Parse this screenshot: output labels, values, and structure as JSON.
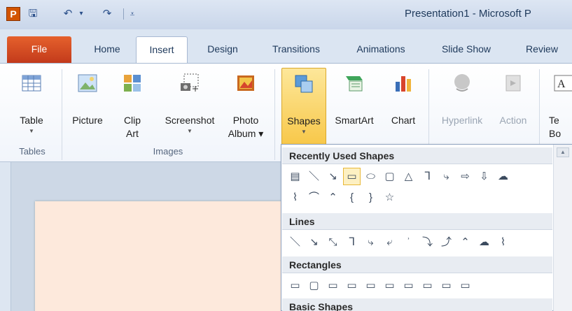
{
  "window": {
    "title": "Presentation1  -  Microsoft P",
    "app_icon": "P"
  },
  "qat": {
    "save": "🖫",
    "undo": "↶",
    "undo_more": "▾",
    "redo": "↷",
    "customize": "⩡"
  },
  "tabs": [
    {
      "label": "File"
    },
    {
      "label": "Home"
    },
    {
      "label": "Insert"
    },
    {
      "label": "Design"
    },
    {
      "label": "Transitions"
    },
    {
      "label": "Animations"
    },
    {
      "label": "Slide Show"
    },
    {
      "label": "Review"
    }
  ],
  "groups": {
    "tables": "Tables",
    "images": "Images"
  },
  "buttons": {
    "table": {
      "label": "Table"
    },
    "picture": {
      "label": "Picture"
    },
    "clip_art": {
      "label": "Clip",
      "label2": "Art"
    },
    "screenshot": {
      "label": "Screenshot"
    },
    "photo_album": {
      "label": "Photo",
      "label2": "Album ▾"
    },
    "shapes": {
      "label": "Shapes"
    },
    "smartart": {
      "label": "SmartArt"
    },
    "chart": {
      "label": "Chart"
    },
    "hyperlink": {
      "label": "Hyperlink"
    },
    "action": {
      "label": "Action"
    },
    "textbox": {
      "label": "Te",
      "label2": "Bo"
    }
  },
  "dropdown": {
    "sections": {
      "recent": "Recently Used Shapes",
      "lines": "Lines",
      "rectangles": "Rectangles",
      "basic": "Basic Shapes"
    },
    "recent_row1": [
      "▤",
      "＼",
      "↘",
      "▭",
      "⬭",
      "▢",
      "△",
      "ᒣ",
      "⤷",
      "⇨",
      "⇩",
      "☁"
    ],
    "recent_row2": [
      "⌇",
      "⌒",
      "⌃",
      "{",
      "}",
      "☆"
    ],
    "lines_row": [
      "＼",
      "↘",
      "⤡",
      "ᒣ",
      "⤷",
      "⤶",
      "ʾ",
      "⤵",
      "⤴",
      "⌃",
      "☁",
      "⌇"
    ],
    "rect_row": [
      "▭",
      "▢",
      "▭",
      "▭",
      "▭",
      "▭",
      "▭",
      "▭",
      "▭",
      "▭"
    ]
  },
  "colors": {
    "accent": "#f8c84a",
    "file_tab": "#d14a1e"
  }
}
